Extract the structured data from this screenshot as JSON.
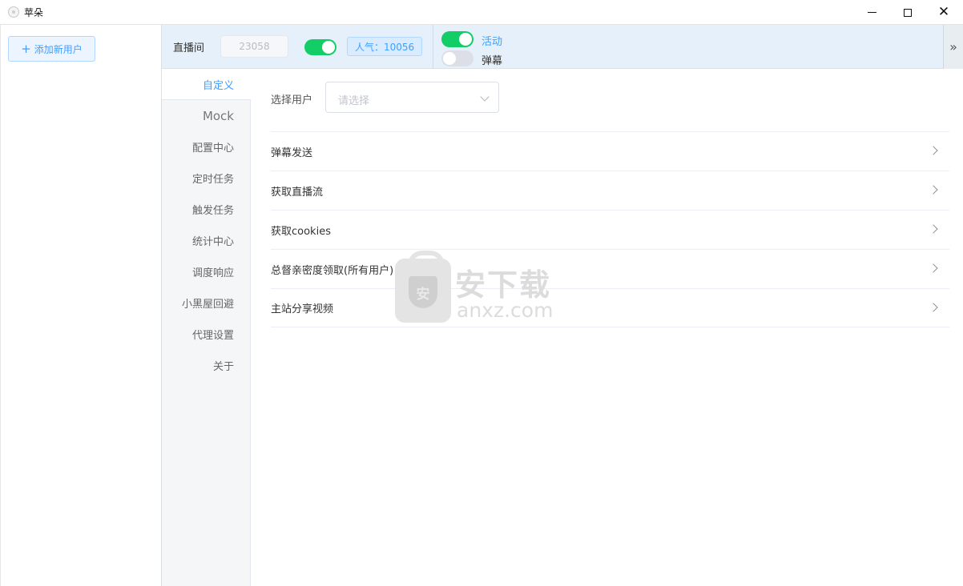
{
  "window": {
    "title": "苹朵",
    "icon": "app-logo-icon",
    "controls": {
      "minimize": "minimize-icon",
      "maximize": "maximize-icon",
      "close": "✕"
    }
  },
  "user_panel": {
    "add_user_icon": "+",
    "add_user_label": "添加新用户"
  },
  "topbar": {
    "room_label": "直播间",
    "room_placeholder": "23058",
    "room_switch_on": true,
    "popularity": "人气：10056",
    "activity_label": "活动",
    "activity_on": true,
    "danmaku_label": "弹幕",
    "danmaku_on": false,
    "expand_icon": "»"
  },
  "tabs": [
    {
      "label": "自定义",
      "active": true
    },
    {
      "label": "Mock"
    },
    {
      "label": "配置中心"
    },
    {
      "label": "定时任务"
    },
    {
      "label": "触发任务"
    },
    {
      "label": "统计中心"
    },
    {
      "label": "调度响应"
    },
    {
      "label": "小黑屋回避"
    },
    {
      "label": "代理设置"
    },
    {
      "label": "关于"
    }
  ],
  "content": {
    "select_user_label": "选择用户",
    "select_user_placeholder": "请选择",
    "items": [
      {
        "label": "弹幕发送"
      },
      {
        "label": "获取直播流"
      },
      {
        "label": "获取cookies"
      },
      {
        "label": "总督亲密度领取(所有用户)"
      },
      {
        "label": "主站分享视频"
      }
    ]
  },
  "watermark": {
    "text_cn": "安下载",
    "text_en": "anxz.com",
    "shield_char": "安"
  },
  "colors": {
    "accent": "#409eff",
    "switch_on": "#13ce66",
    "topbar_bg": "#e6f0fa"
  }
}
